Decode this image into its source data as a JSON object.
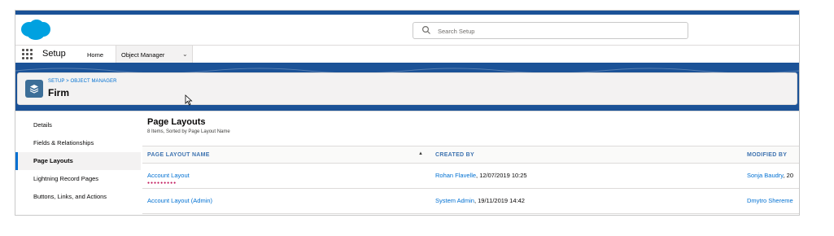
{
  "brand": {
    "primary": "#1b5297",
    "link": "#0070d2",
    "sidebar_active": "#0070d2",
    "object_icon": "#3c6e98"
  },
  "topbar": {
    "logo_icon": "salesforce-cloud-icon",
    "search": {
      "placeholder": "Search Setup",
      "icon": "search-icon"
    }
  },
  "navbar": {
    "app_launcher_icon": "app-launcher-icon",
    "app_name": "Setup",
    "tabs": [
      {
        "label": "Home"
      },
      {
        "label": "Object Manager",
        "dropdown_icon": "chevron-down-icon"
      }
    ]
  },
  "object_header": {
    "icon": "layers-icon",
    "breadcrumb": "SETUP > OBJECT MANAGER",
    "title": "Firm"
  },
  "sidebar": {
    "items": [
      {
        "label": "Details"
      },
      {
        "label": "Fields & Relationships"
      },
      {
        "label": "Page Layouts",
        "active": true
      },
      {
        "label": "Lightning Record Pages"
      },
      {
        "label": "Buttons, Links, and Actions"
      }
    ]
  },
  "main": {
    "title": "Page Layouts",
    "subtitle": "8 Items, Sorted by Page Layout Name",
    "columns": [
      {
        "label": "PAGE LAYOUT NAME",
        "sort_icon": "sort-ascending-icon"
      },
      {
        "label": "CREATED BY"
      },
      {
        "label": "MODIFIED BY"
      }
    ],
    "rows": [
      {
        "name": "Account Layout",
        "created_by_user": "Rohan Flavelle",
        "created_by_date": ", 12/07/2019 10:25",
        "modified_by_user": "Sonja Baudry",
        "modified_by_date": ", 20"
      },
      {
        "name": "Account Layout (Admin)",
        "created_by_user": "System Admin",
        "created_by_date": ", 19/11/2019 14:42",
        "modified_by_user": "Dmytro Shereme",
        "modified_by_date": ""
      }
    ]
  }
}
